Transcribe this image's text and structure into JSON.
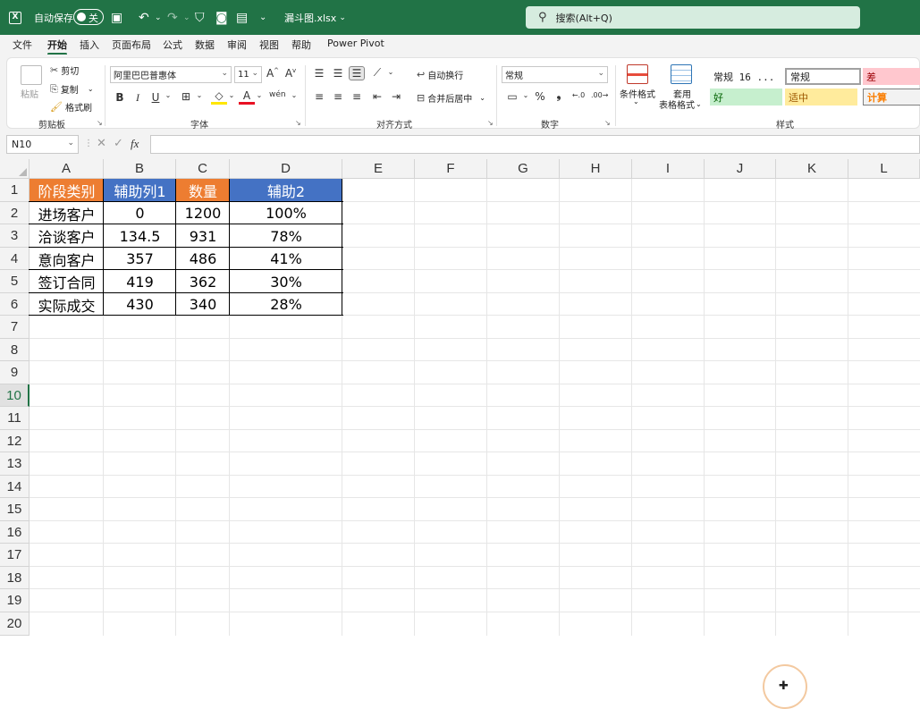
{
  "titlebar": {
    "autosave_label": "自动保存",
    "autosave_state": "关",
    "filename": "漏斗图.xlsx",
    "search_placeholder": "搜索(Alt+Q)",
    "brand_color": "#217346"
  },
  "menu": {
    "tabs": [
      "文件",
      "开始",
      "插入",
      "页面布局",
      "公式",
      "数据",
      "审阅",
      "视图",
      "帮助",
      "Power Pivot"
    ],
    "active": "开始"
  },
  "ribbon": {
    "clipboard": {
      "paste": "粘贴",
      "cut": "剪切",
      "copy": "复制",
      "format_painter": "格式刷",
      "label": "剪贴板"
    },
    "font": {
      "font_name": "阿里巴巴普惠体",
      "font_size": "11",
      "bold": "B",
      "italic": "I",
      "underline": "U",
      "label": "字体",
      "grow": "A",
      "shrink": "A"
    },
    "alignment": {
      "wrap_text": "自动换行",
      "merge_center": "合并后居中",
      "label": "对齐方式"
    },
    "number": {
      "format": "常规",
      "percent": "%",
      "comma": "❟",
      "label": "数字"
    },
    "styles": {
      "conditional_format": "条件格式",
      "table_format_1": "套用",
      "table_format_2": "表格格式",
      "normal_16": "常规 16 ...",
      "normal": "常规",
      "bad": "差",
      "good": "好",
      "neutral": "适中",
      "calc": "计算",
      "label": "样式"
    }
  },
  "formula_bar": {
    "name_box": "N10",
    "fx": "fx",
    "value": ""
  },
  "sheet": {
    "columns": [
      "A",
      "B",
      "C",
      "D",
      "E",
      "F",
      "G",
      "H",
      "I",
      "J",
      "K",
      "L"
    ],
    "rows": [
      "1",
      "2",
      "3",
      "4",
      "5",
      "6",
      "7",
      "8",
      "9",
      "10",
      "11",
      "12",
      "13",
      "14",
      "15",
      "16",
      "17",
      "18",
      "19",
      "20"
    ],
    "selected_row": "10",
    "header": [
      "阶段类别",
      "辅助列1",
      "数量",
      "辅助2"
    ],
    "header_colors": [
      "#ed7d31",
      "#4472c4",
      "#ed7d31",
      "#4472c4"
    ],
    "data": [
      [
        "进场客户",
        "0",
        "1200",
        "100%"
      ],
      [
        "洽谈客户",
        "134.5",
        "931",
        "78%"
      ],
      [
        "意向客户",
        "357",
        "486",
        "41%"
      ],
      [
        "签订合同",
        "419",
        "362",
        "30%"
      ],
      [
        "实际成交",
        "430",
        "340",
        "28%"
      ]
    ]
  }
}
